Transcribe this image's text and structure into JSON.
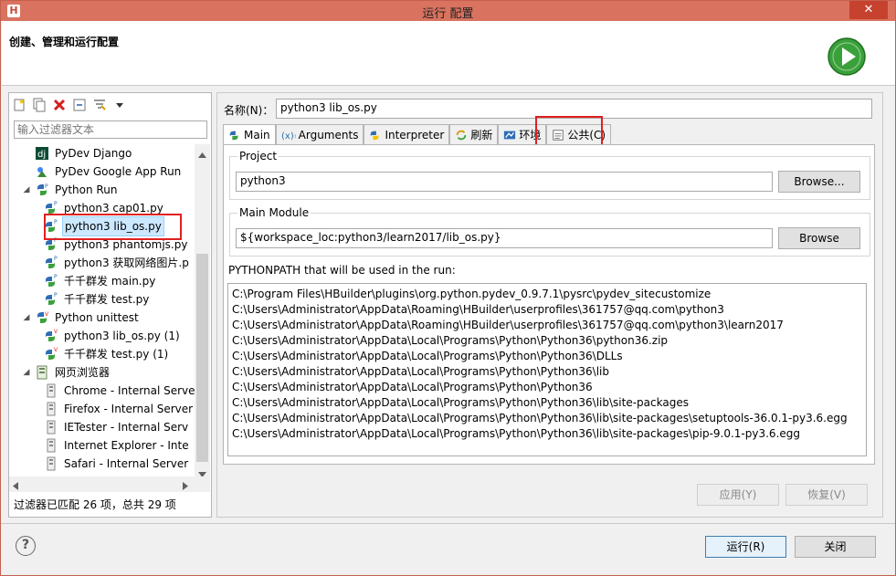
{
  "window": {
    "app_icon": "H",
    "title": "运行 配置",
    "close": "✕"
  },
  "header": {
    "title": "创建、管理和运行配置"
  },
  "left": {
    "filter_placeholder": "输入过滤器文本",
    "tree": [
      {
        "label": "PyDev Django",
        "indent": 1,
        "icon": "django-icon"
      },
      {
        "label": "PyDev Google App Run",
        "indent": 1,
        "icon": "google-app-icon"
      },
      {
        "label": "Python Run",
        "indent": 1,
        "icon": "python-run-icon",
        "expanded": true
      },
      {
        "label": "python3 cap01.py",
        "indent": 2,
        "icon": "python-file-icon"
      },
      {
        "label": "python3 lib_os.py",
        "indent": 2,
        "icon": "python-file-icon",
        "selected": true
      },
      {
        "label": "python3 phantomjs.py",
        "indent": 2,
        "icon": "python-file-icon"
      },
      {
        "label": "python3 获取网络图片.p",
        "indent": 2,
        "icon": "python-file-icon"
      },
      {
        "label": "千千群发 main.py",
        "indent": 2,
        "icon": "python-file-icon"
      },
      {
        "label": "千千群发 test.py",
        "indent": 2,
        "icon": "python-file-icon"
      },
      {
        "label": "Python unittest",
        "indent": 1,
        "icon": "python-unittest-icon",
        "expanded": true
      },
      {
        "label": "python3 lib_os.py (1)",
        "indent": 2,
        "icon": "python-test-icon"
      },
      {
        "label": "千千群发 test.py (1)",
        "indent": 2,
        "icon": "python-test-icon"
      },
      {
        "label": "网页浏览器",
        "indent": 1,
        "icon": "browser-group-icon",
        "expanded": true
      },
      {
        "label": "Chrome - Internal Serve",
        "indent": 2,
        "icon": "browser-icon"
      },
      {
        "label": "Firefox - Internal Server",
        "indent": 2,
        "icon": "browser-icon"
      },
      {
        "label": "IETester - Internal Serv",
        "indent": 2,
        "icon": "browser-icon"
      },
      {
        "label": "Internet Explorer - Inte",
        "indent": 2,
        "icon": "browser-icon"
      },
      {
        "label": "Safari - Internal Server",
        "indent": 2,
        "icon": "browser-icon"
      }
    ],
    "status": "过滤器已匹配 26 项，总共 29 项"
  },
  "right": {
    "name_label": "名称(N)：",
    "name_value": "python3 lib_os.py",
    "tabs": [
      {
        "label": "Main",
        "icon": "main-tab-icon",
        "active": true
      },
      {
        "label": "Arguments",
        "icon": "arguments-icon"
      },
      {
        "label": "Interpreter",
        "icon": "interpreter-icon"
      },
      {
        "label": "刷新",
        "icon": "refresh-icon"
      },
      {
        "label": "环境",
        "icon": "environment-icon"
      },
      {
        "label": "公共(C)",
        "icon": "common-icon"
      }
    ],
    "project": {
      "label": "Project",
      "value": "python3",
      "browse": "Browse..."
    },
    "main_module": {
      "label": "Main Module",
      "value": "${workspace_loc:python3/learn2017/lib_os.py}",
      "browse": "Browse"
    },
    "pythonpath_label": "PYTHONPATH that will be used in the run:",
    "pythonpath": [
      "C:\\Program Files\\HBuilder\\plugins\\org.python.pydev_0.9.7.1\\pysrc\\pydev_sitecustomize",
      "C:\\Users\\Administrator\\AppData\\Roaming\\HBuilder\\userprofiles\\361757@qq.com\\python3",
      "C:\\Users\\Administrator\\AppData\\Roaming\\HBuilder\\userprofiles\\361757@qq.com\\python3\\learn2017",
      "C:\\Users\\Administrator\\AppData\\Local\\Programs\\Python\\Python36\\python36.zip",
      "C:\\Users\\Administrator\\AppData\\Local\\Programs\\Python\\Python36\\DLLs",
      "C:\\Users\\Administrator\\AppData\\Local\\Programs\\Python\\Python36\\lib",
      "C:\\Users\\Administrator\\AppData\\Local\\Programs\\Python\\Python36",
      "C:\\Users\\Administrator\\AppData\\Local\\Programs\\Python\\Python36\\lib\\site-packages",
      "C:\\Users\\Administrator\\AppData\\Local\\Programs\\Python\\Python36\\lib\\site-packages\\setuptools-36.0.1-py3.6.egg",
      "C:\\Users\\Administrator\\AppData\\Local\\Programs\\Python\\Python36\\lib\\site-packages\\pip-9.0.1-py3.6.egg"
    ],
    "apply": "应用(Y)",
    "revert": "恢复(V)"
  },
  "footer": {
    "help": "?",
    "run": "运行(R)",
    "close": "关闭"
  },
  "colors": {
    "titlebar": "#d9735f",
    "highlight": "#e02020",
    "selection": "#cce8ff",
    "run_green": "#3aa13a"
  }
}
